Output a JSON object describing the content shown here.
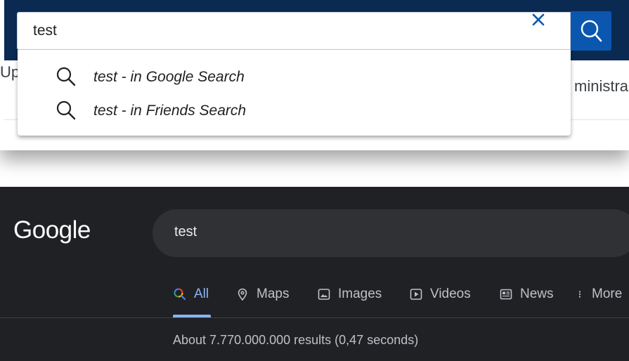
{
  "site_search": {
    "query": "test",
    "nav_left_fragment": "Up",
    "nav_right_fragment": "ministra",
    "suggestions": [
      {
        "label": "test - in Google Search",
        "icon": "search-icon"
      },
      {
        "label": "test - in Friends Search",
        "icon": "search-icon"
      }
    ],
    "colors": {
      "header": "#0b2a52",
      "submit": "#0b57b0",
      "clear_icon": "#0b57b0"
    }
  },
  "google": {
    "logo": "Google",
    "query": "test",
    "tabs": [
      {
        "label": "All",
        "icon": "search-icon",
        "active": true
      },
      {
        "label": "Maps",
        "icon": "map-pin-icon",
        "active": false
      },
      {
        "label": "Images",
        "icon": "image-icon",
        "active": false
      },
      {
        "label": "Videos",
        "icon": "video-icon",
        "active": false
      },
      {
        "label": "News",
        "icon": "news-icon",
        "active": false
      },
      {
        "label": "More",
        "icon": "more-vertical-icon",
        "active": false
      }
    ],
    "result_stats": "About 7.770.000.000 results (0,47 seconds)",
    "colors": {
      "background": "#202124",
      "active_tab": "#8ab4f8"
    }
  }
}
